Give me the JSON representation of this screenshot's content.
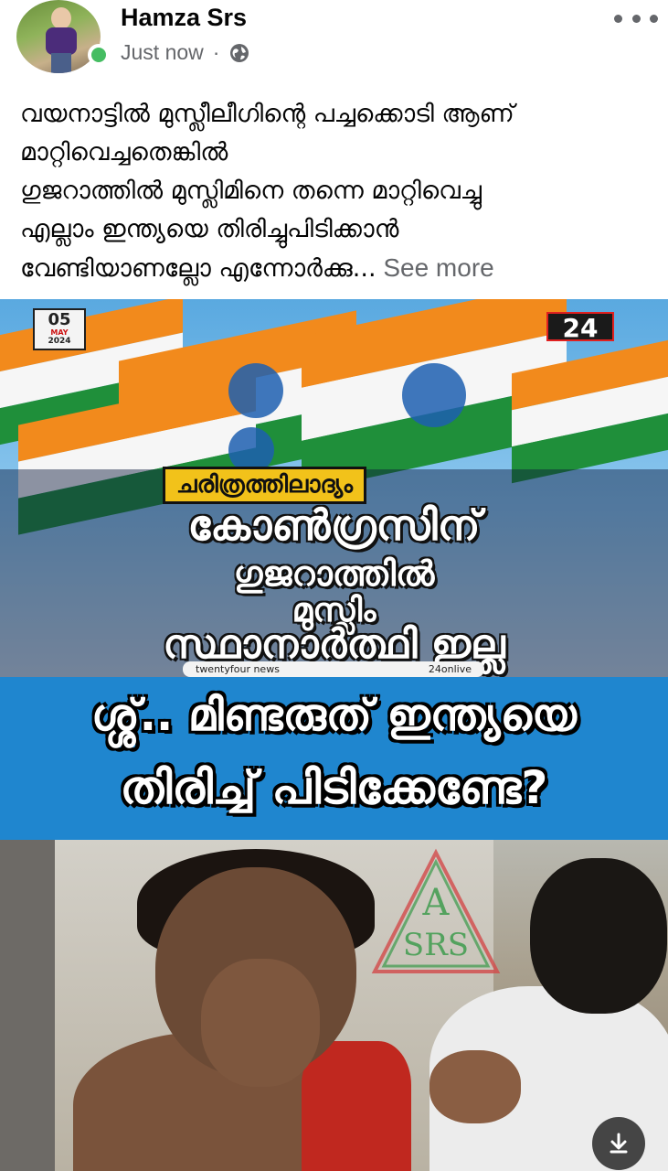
{
  "post": {
    "author": "Hamza Srs",
    "time": "Just now",
    "separator": "·",
    "privacy_icon": "globe-icon",
    "text_lines": [
      "വയനാട്ടിൽ മുസ്ലീലീഗിന്റെ പച്ചക്കൊടി ആണ്",
      "മാറ്റിവെച്ചതെങ്കിൽ",
      "ഗുജറാത്തിൽ മുസ്ലിമിനെ തന്നെ മാറ്റിവെച്ചു",
      "എല്ലാം ഇന്ത്യയെ തിരിച്ചുപിടിക്കാൻ",
      "വേണ്ടിയാണല്ലോ എന്നോർക്കു..."
    ],
    "see_more": " See more"
  },
  "image": {
    "date_day": "05",
    "date_month": "MAY",
    "date_year": "2024",
    "channel_logo": "24",
    "subtag": "ചരിത്രത്തിലാദ്യം",
    "headline": [
      "കോൺഗ്രസിന്",
      "ഗുജറാത്തിൽ",
      "മുസ്ലിം",
      "സ്ഥാനാർത്ഥി ഇല്ല"
    ],
    "social_left": "twentyfour news",
    "social_right": "24onlive",
    "caption_line1": "ശ്ശ്.. മിണ്ടരുത് ഇന്ത്യയെ",
    "caption_line2": "തിരിച്ച് പിടിക്കേണ്ടേ?",
    "watermark_top": "A",
    "watermark_bottom": "SRS"
  },
  "colors": {
    "online": "#45bd62",
    "panel_blue": "#1f86cf",
    "subtag_yellow": "#f2c21a"
  }
}
